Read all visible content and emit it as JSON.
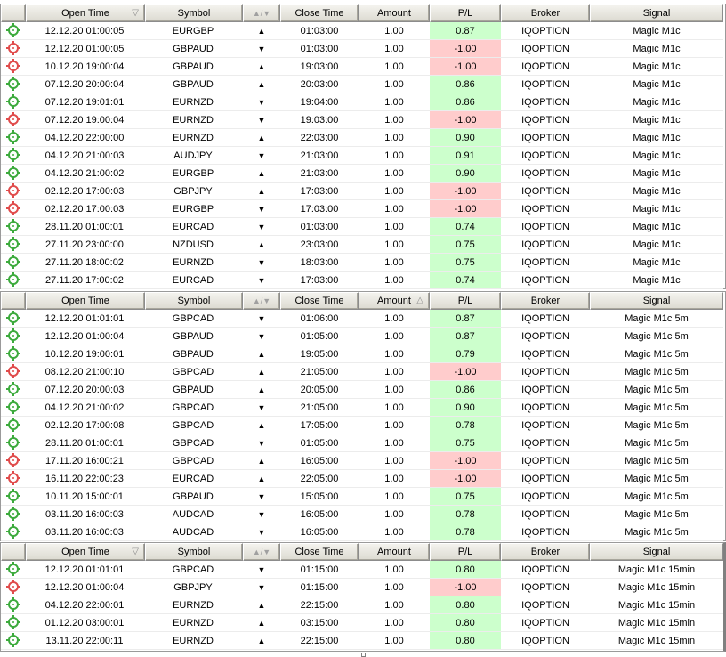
{
  "colors": {
    "win_bg": "#ccffcc",
    "loss_bg": "#ffcccc",
    "win_icon": "#3caa3c",
    "loss_icon": "#e04b4b"
  },
  "icons": {
    "win": "target-win-icon",
    "loss": "target-loss-icon",
    "up": "▲",
    "down": "▼",
    "sort_desc": "▽",
    "sort_asc": "△",
    "dir_header": "▲/▼"
  },
  "panels": [
    {
      "headers": {
        "open_time": "Open Time",
        "symbol": "Symbol",
        "close_time": "Close Time",
        "amount": "Amount",
        "pl": "P/L",
        "broker": "Broker",
        "signal": "Signal"
      },
      "sorted_column": "open_time",
      "sort_glyph": "▽",
      "rows": [
        {
          "result": "win",
          "open": "12.12.20 01:00:05",
          "symbol": "EURGBP",
          "dir": "▲",
          "close": "01:03:00",
          "amount": "1.00",
          "pl": "0.87",
          "broker": "IQOPTION",
          "signal": "Magic M1c"
        },
        {
          "result": "loss",
          "open": "12.12.20 01:00:05",
          "symbol": "GBPAUD",
          "dir": "▼",
          "close": "01:03:00",
          "amount": "1.00",
          "pl": "-1.00",
          "broker": "IQOPTION",
          "signal": "Magic M1c"
        },
        {
          "result": "loss",
          "open": "10.12.20 19:00:04",
          "symbol": "GBPAUD",
          "dir": "▲",
          "close": "19:03:00",
          "amount": "1.00",
          "pl": "-1.00",
          "broker": "IQOPTION",
          "signal": "Magic M1c"
        },
        {
          "result": "win",
          "open": "07.12.20 20:00:04",
          "symbol": "GBPAUD",
          "dir": "▲",
          "close": "20:03:00",
          "amount": "1.00",
          "pl": "0.86",
          "broker": "IQOPTION",
          "signal": "Magic M1c"
        },
        {
          "result": "win",
          "open": "07.12.20 19:01:01",
          "symbol": "EURNZD",
          "dir": "▼",
          "close": "19:04:00",
          "amount": "1.00",
          "pl": "0.86",
          "broker": "IQOPTION",
          "signal": "Magic M1c"
        },
        {
          "result": "loss",
          "open": "07.12.20 19:00:04",
          "symbol": "EURNZD",
          "dir": "▼",
          "close": "19:03:00",
          "amount": "1.00",
          "pl": "-1.00",
          "broker": "IQOPTION",
          "signal": "Magic M1c"
        },
        {
          "result": "win",
          "open": "04.12.20 22:00:00",
          "symbol": "EURNZD",
          "dir": "▲",
          "close": "22:03:00",
          "amount": "1.00",
          "pl": "0.90",
          "broker": "IQOPTION",
          "signal": "Magic M1c"
        },
        {
          "result": "win",
          "open": "04.12.20 21:00:03",
          "symbol": "AUDJPY",
          "dir": "▼",
          "close": "21:03:00",
          "amount": "1.00",
          "pl": "0.91",
          "broker": "IQOPTION",
          "signal": "Magic M1c"
        },
        {
          "result": "win",
          "open": "04.12.20 21:00:02",
          "symbol": "EURGBP",
          "dir": "▲",
          "close": "21:03:00",
          "amount": "1.00",
          "pl": "0.90",
          "broker": "IQOPTION",
          "signal": "Magic M1c"
        },
        {
          "result": "loss",
          "open": "02.12.20 17:00:03",
          "symbol": "GBPJPY",
          "dir": "▲",
          "close": "17:03:00",
          "amount": "1.00",
          "pl": "-1.00",
          "broker": "IQOPTION",
          "signal": "Magic M1c"
        },
        {
          "result": "loss",
          "open": "02.12.20 17:00:03",
          "symbol": "EURGBP",
          "dir": "▼",
          "close": "17:03:00",
          "amount": "1.00",
          "pl": "-1.00",
          "broker": "IQOPTION",
          "signal": "Magic M1c"
        },
        {
          "result": "win",
          "open": "28.11.20 01:00:01",
          "symbol": "EURCAD",
          "dir": "▼",
          "close": "01:03:00",
          "amount": "1.00",
          "pl": "0.74",
          "broker": "IQOPTION",
          "signal": "Magic M1c"
        },
        {
          "result": "win",
          "open": "27.11.20 23:00:00",
          "symbol": "NZDUSD",
          "dir": "▲",
          "close": "23:03:00",
          "amount": "1.00",
          "pl": "0.75",
          "broker": "IQOPTION",
          "signal": "Magic M1c"
        },
        {
          "result": "win",
          "open": "27.11.20 18:00:02",
          "symbol": "EURNZD",
          "dir": "▼",
          "close": "18:03:00",
          "amount": "1.00",
          "pl": "0.75",
          "broker": "IQOPTION",
          "signal": "Magic M1c"
        },
        {
          "result": "win",
          "open": "27.11.20 17:00:02",
          "symbol": "EURCAD",
          "dir": "▼",
          "close": "17:03:00",
          "amount": "1.00",
          "pl": "0.74",
          "broker": "IQOPTION",
          "signal": "Magic M1c"
        }
      ]
    },
    {
      "headers": {
        "open_time": "Open Time",
        "symbol": "Symbol",
        "close_time": "Close Time",
        "amount": "Amount",
        "pl": "P/L",
        "broker": "Broker",
        "signal": "Signal"
      },
      "sorted_column": "amount",
      "sort_glyph": "△",
      "rows": [
        {
          "result": "win",
          "open": "12.12.20 01:01:01",
          "symbol": "GBPCAD",
          "dir": "▼",
          "close": "01:06:00",
          "amount": "1.00",
          "pl": "0.87",
          "broker": "IQOPTION",
          "signal": "Magic M1c 5m"
        },
        {
          "result": "win",
          "open": "12.12.20 01:00:04",
          "symbol": "GBPAUD",
          "dir": "▼",
          "close": "01:05:00",
          "amount": "1.00",
          "pl": "0.87",
          "broker": "IQOPTION",
          "signal": "Magic M1c 5m"
        },
        {
          "result": "win",
          "open": "10.12.20 19:00:01",
          "symbol": "GBPAUD",
          "dir": "▲",
          "close": "19:05:00",
          "amount": "1.00",
          "pl": "0.79",
          "broker": "IQOPTION",
          "signal": "Magic M1c 5m"
        },
        {
          "result": "loss",
          "open": "08.12.20 21:00:10",
          "symbol": "GBPCAD",
          "dir": "▲",
          "close": "21:05:00",
          "amount": "1.00",
          "pl": "-1.00",
          "broker": "IQOPTION",
          "signal": "Magic M1c 5m"
        },
        {
          "result": "win",
          "open": "07.12.20 20:00:03",
          "symbol": "GBPAUD",
          "dir": "▲",
          "close": "20:05:00",
          "amount": "1.00",
          "pl": "0.86",
          "broker": "IQOPTION",
          "signal": "Magic M1c 5m"
        },
        {
          "result": "win",
          "open": "04.12.20 21:00:02",
          "symbol": "GBPCAD",
          "dir": "▼",
          "close": "21:05:00",
          "amount": "1.00",
          "pl": "0.90",
          "broker": "IQOPTION",
          "signal": "Magic M1c 5m"
        },
        {
          "result": "win",
          "open": "02.12.20 17:00:08",
          "symbol": "GBPCAD",
          "dir": "▲",
          "close": "17:05:00",
          "amount": "1.00",
          "pl": "0.78",
          "broker": "IQOPTION",
          "signal": "Magic M1c 5m"
        },
        {
          "result": "win",
          "open": "28.11.20 01:00:01",
          "symbol": "GBPCAD",
          "dir": "▼",
          "close": "01:05:00",
          "amount": "1.00",
          "pl": "0.75",
          "broker": "IQOPTION",
          "signal": "Magic M1c 5m"
        },
        {
          "result": "loss",
          "open": "17.11.20 16:00:21",
          "symbol": "GBPCAD",
          "dir": "▲",
          "close": "16:05:00",
          "amount": "1.00",
          "pl": "-1.00",
          "broker": "IQOPTION",
          "signal": "Magic M1c 5m"
        },
        {
          "result": "loss",
          "open": "16.11.20 22:00:23",
          "symbol": "EURCAD",
          "dir": "▲",
          "close": "22:05:00",
          "amount": "1.00",
          "pl": "-1.00",
          "broker": "IQOPTION",
          "signal": "Magic M1c 5m"
        },
        {
          "result": "win",
          "open": "10.11.20 15:00:01",
          "symbol": "GBPAUD",
          "dir": "▼",
          "close": "15:05:00",
          "amount": "1.00",
          "pl": "0.75",
          "broker": "IQOPTION",
          "signal": "Magic M1c 5m"
        },
        {
          "result": "win",
          "open": "03.11.20 16:00:03",
          "symbol": "AUDCAD",
          "dir": "▼",
          "close": "16:05:00",
          "amount": "1.00",
          "pl": "0.78",
          "broker": "IQOPTION",
          "signal": "Magic M1c 5m"
        },
        {
          "result": "win",
          "open": "03.11.20 16:00:03",
          "symbol": "AUDCAD",
          "dir": "▼",
          "close": "16:05:00",
          "amount": "1.00",
          "pl": "0.78",
          "broker": "IQOPTION",
          "signal": "Magic M1c 5m"
        }
      ]
    },
    {
      "headers": {
        "open_time": "Open Time",
        "symbol": "Symbol",
        "close_time": "Close Time",
        "amount": "Amount",
        "pl": "P/L",
        "broker": "Broker",
        "signal": "Signal"
      },
      "sorted_column": "open_time",
      "sort_glyph": "▽",
      "rows": [
        {
          "result": "win",
          "open": "12.12.20 01:01:01",
          "symbol": "GBPCAD",
          "dir": "▼",
          "close": "01:15:00",
          "amount": "1.00",
          "pl": "0.80",
          "broker": "IQOPTION",
          "signal": "Magic M1c 15min"
        },
        {
          "result": "loss",
          "open": "12.12.20 01:00:04",
          "symbol": "GBPJPY",
          "dir": "▼",
          "close": "01:15:00",
          "amount": "1.00",
          "pl": "-1.00",
          "broker": "IQOPTION",
          "signal": "Magic M1c 15min"
        },
        {
          "result": "win",
          "open": "04.12.20 22:00:01",
          "symbol": "EURNZD",
          "dir": "▲",
          "close": "22:15:00",
          "amount": "1.00",
          "pl": "0.80",
          "broker": "IQOPTION",
          "signal": "Magic M1c 15min"
        },
        {
          "result": "win",
          "open": "01.12.20 03:00:01",
          "symbol": "EURNZD",
          "dir": "▲",
          "close": "03:15:00",
          "amount": "1.00",
          "pl": "0.80",
          "broker": "IQOPTION",
          "signal": "Magic M1c 15min"
        },
        {
          "result": "win",
          "open": "13.11.20 22:00:11",
          "symbol": "EURNZD",
          "dir": "▲",
          "close": "22:15:00",
          "amount": "1.00",
          "pl": "0.80",
          "broker": "IQOPTION",
          "signal": "Magic M1c 15min"
        }
      ]
    }
  ]
}
